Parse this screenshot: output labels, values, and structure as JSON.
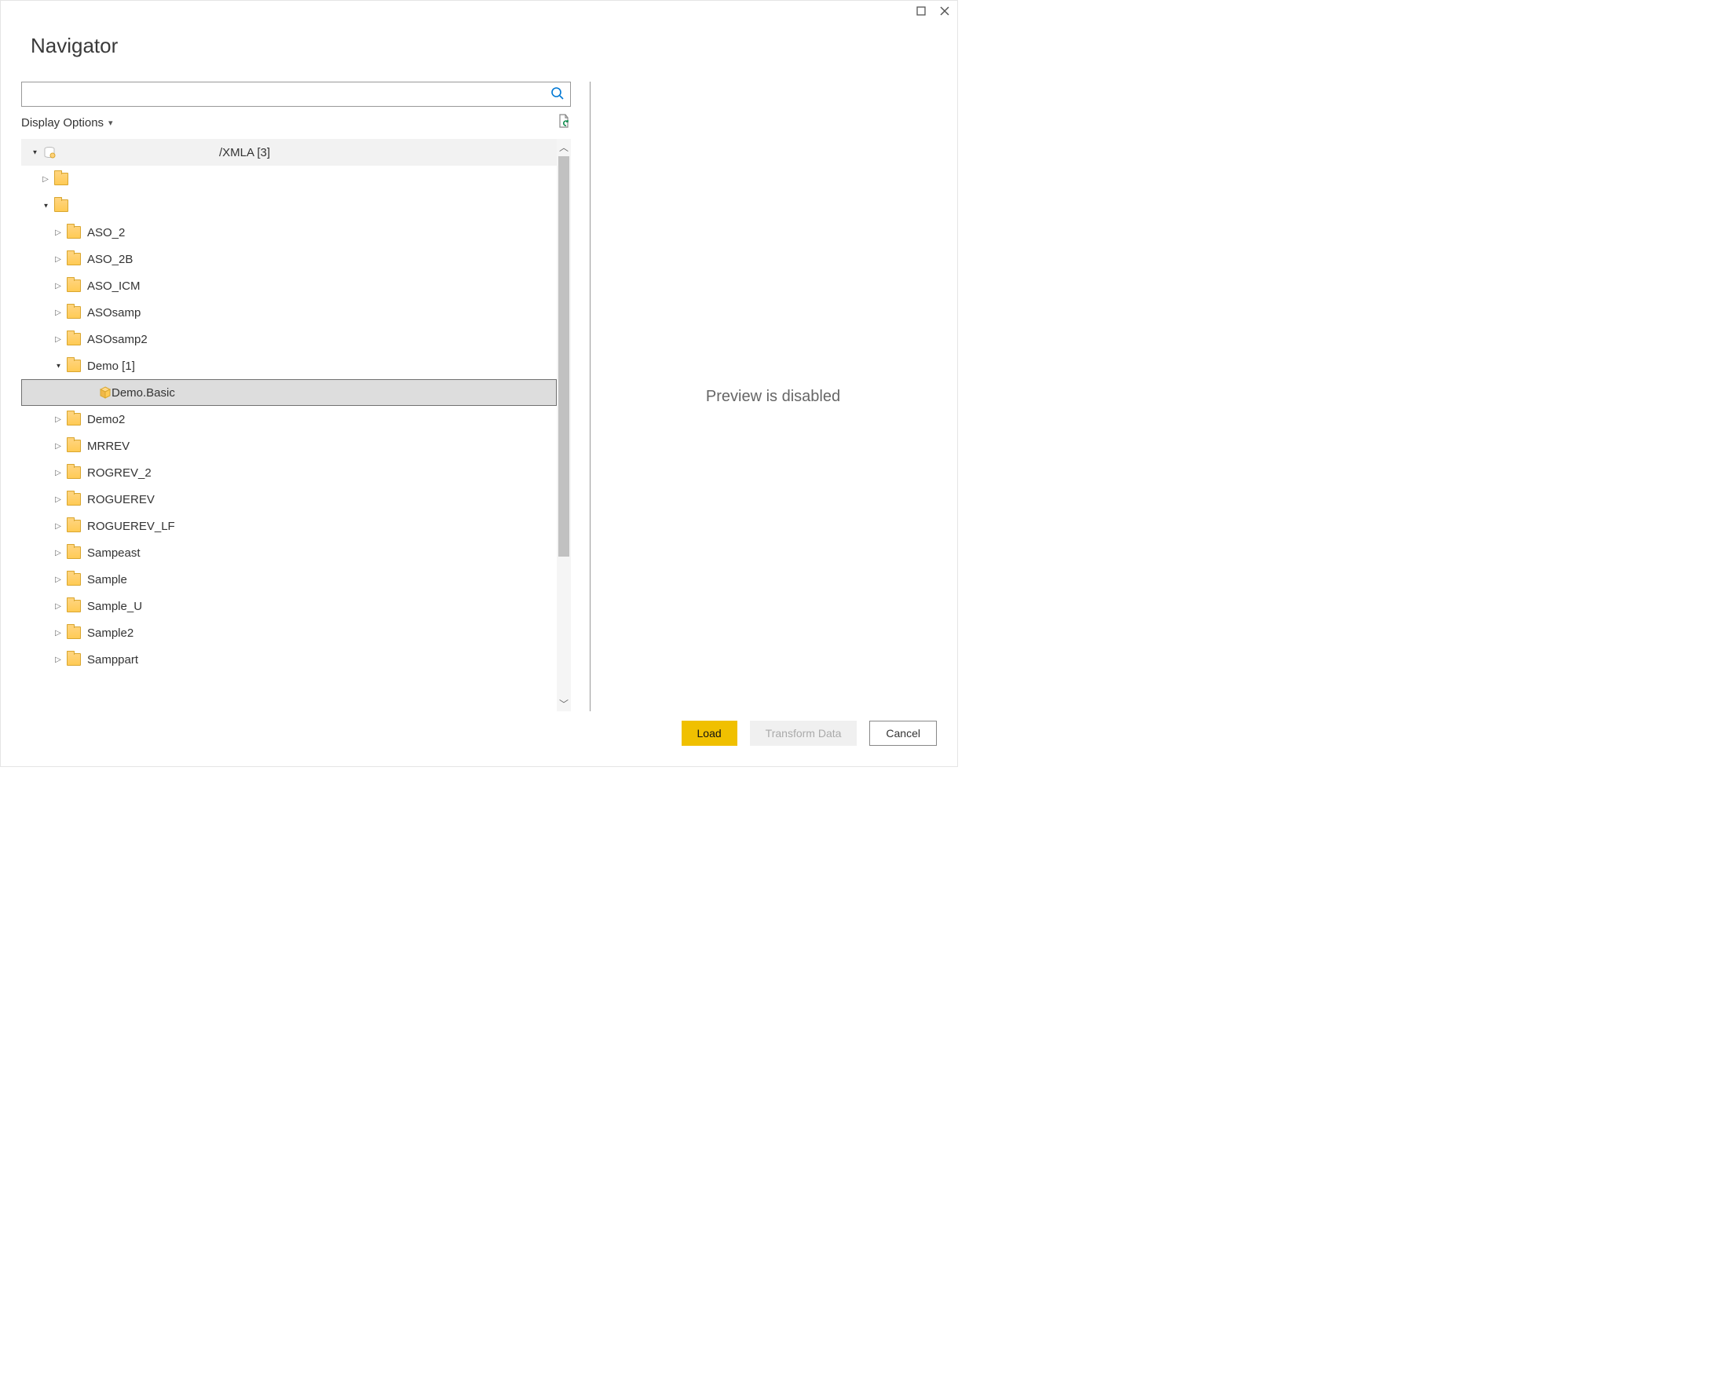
{
  "title": "Navigator",
  "search": {
    "value": ""
  },
  "display_options_label": "Display Options",
  "preview_message": "Preview is disabled",
  "buttons": {
    "load": "Load",
    "transform": "Transform Data",
    "cancel": "Cancel"
  },
  "tree": {
    "root_label": "/XMLA [3]",
    "blank1": "",
    "blank2": "",
    "items": [
      {
        "label": "ASO_2"
      },
      {
        "label": "ASO_2B"
      },
      {
        "label": "ASO_ICM"
      },
      {
        "label": "ASOsamp"
      },
      {
        "label": "ASOsamp2"
      },
      {
        "label": "Demo [1]",
        "open": true,
        "child": "Demo.Basic"
      },
      {
        "label": "Demo2"
      },
      {
        "label": "MRREV"
      },
      {
        "label": "ROGREV_2"
      },
      {
        "label": "ROGUEREV"
      },
      {
        "label": "ROGUEREV_LF"
      },
      {
        "label": "Sampeast"
      },
      {
        "label": "Sample"
      },
      {
        "label": "Sample_U"
      },
      {
        "label": "Sample2"
      },
      {
        "label": "Samppart"
      }
    ]
  }
}
